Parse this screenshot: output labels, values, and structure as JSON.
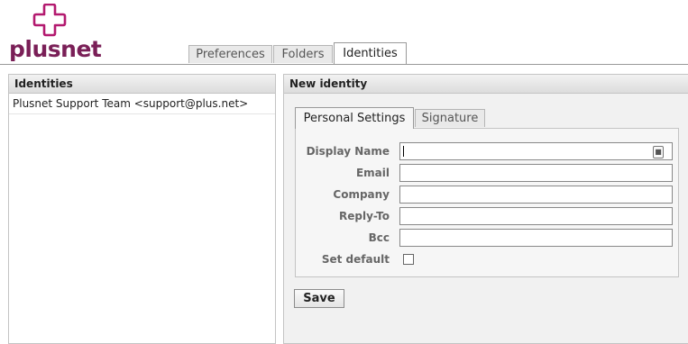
{
  "brand": {
    "name": "plusnet",
    "logo_color": "#b3196f",
    "text_color": "#7a1f57"
  },
  "tabs": [
    {
      "label": "Preferences",
      "active": false
    },
    {
      "label": "Folders",
      "active": false
    },
    {
      "label": "Identities",
      "active": true
    }
  ],
  "identities_panel": {
    "title": "Identities",
    "items": [
      "Plusnet Support Team <support@plus.net>"
    ]
  },
  "new_identity": {
    "title": "New identity",
    "tabs": [
      {
        "label": "Personal Settings",
        "active": true
      },
      {
        "label": "Signature",
        "active": false
      }
    ],
    "fields": {
      "display_name": {
        "label": "Display Name",
        "value": ""
      },
      "email": {
        "label": "Email",
        "value": ""
      },
      "company": {
        "label": "Company",
        "value": ""
      },
      "reply_to": {
        "label": "Reply-To",
        "value": ""
      },
      "bcc": {
        "label": "Bcc",
        "value": ""
      },
      "set_default": {
        "label": "Set default",
        "checked": false
      }
    },
    "save_label": "Save",
    "contact_icon": "address-book-icon"
  }
}
